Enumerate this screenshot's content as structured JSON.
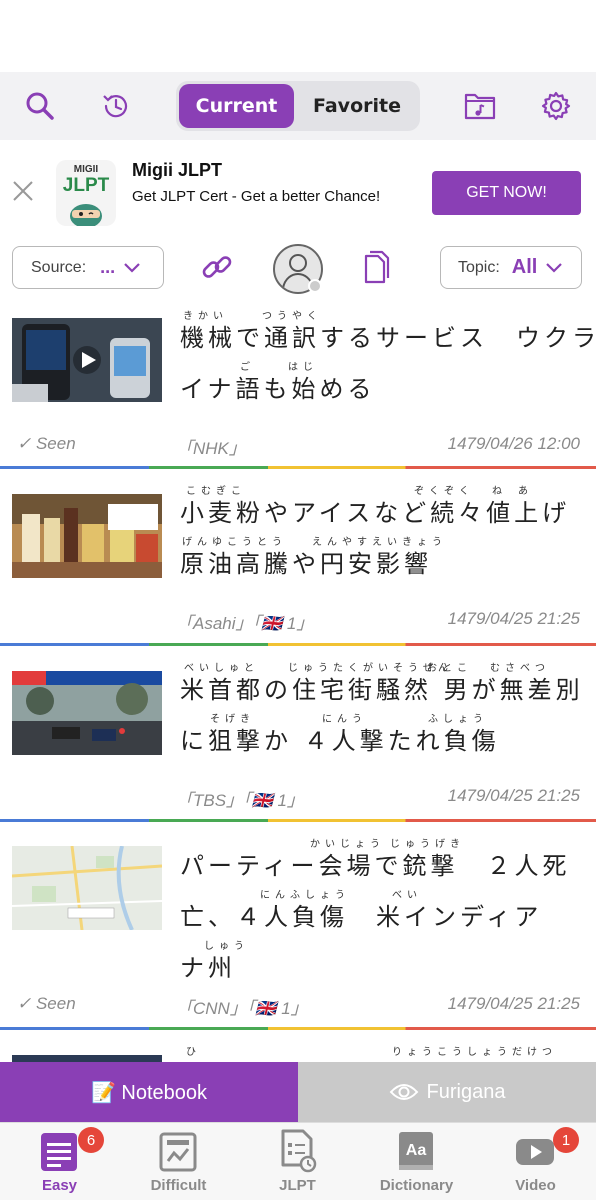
{
  "toolbar": {
    "segment_current": "Current",
    "segment_favorite": "Favorite",
    "icons": [
      "search-icon",
      "history-icon",
      "music-folder-icon",
      "settings-icon"
    ]
  },
  "ad": {
    "logo_top": "MIGII",
    "logo_main": "JLPT",
    "title": "Migii JLPT",
    "subtitle": "Get JLPT Cert - Get a better Chance!",
    "button": "GET NOW!"
  },
  "filters": {
    "source_label": "Source:",
    "source_value": "...",
    "topic_label": "Topic:",
    "topic_value": "All"
  },
  "articles": [
    {
      "lines": [
        {
          "text": "機械で通訳するサービス　ウクラ",
          "ruby": [
            {
              "text": "きかい"
            },
            {
              "text": "つうやく"
            }
          ]
        },
        {
          "text": "イナ語も始める",
          "ruby": [
            {
              "text": "ご"
            },
            {
              "text": "はじ"
            }
          ]
        }
      ],
      "seen": "✓ Seen",
      "source": "「NHK」",
      "date": "1479/04/26 12:00"
    },
    {
      "lines": [
        {
          "text": "小麦粉やアイスなど続々値上げ",
          "ruby": [
            {
              "text": "こむぎこ"
            },
            {
              "text": "ぞくぞく"
            },
            {
              "text": "ね"
            },
            {
              "text": "あ"
            }
          ]
        },
        {
          "text": "原油高騰や円安影響",
          "ruby": [
            {
              "text": "げんゆこうとう"
            },
            {
              "text": "えんやすえいきょう"
            }
          ]
        }
      ],
      "seen": "",
      "source": "「Asahi」「🇬🇧 1」",
      "date": "1479/04/25 21:25"
    },
    {
      "lines": [
        {
          "text": "米首都の住宅街騒然 男が無差別",
          "ruby": [
            {
              "text": "べいしゅと"
            },
            {
              "text": "じゅうたくがいそうぜん"
            },
            {
              "text": "おとこ"
            },
            {
              "text": "むさべつ"
            }
          ]
        },
        {
          "text": "に狙撃か ４人撃たれ負傷",
          "ruby": [
            {
              "text": "そげき"
            },
            {
              "text": "にんう"
            },
            {
              "text": "ふしょう"
            }
          ]
        }
      ],
      "seen": "",
      "source": "「TBS」「🇬🇧 1」",
      "date": "1479/04/25 21:25"
    },
    {
      "lines": [
        {
          "text": "パーティー会場で銃撃　２人死",
          "ruby": [
            {
              "text": "かいじょう"
            },
            {
              "text": "じゅうげき"
            }
          ]
        },
        {
          "text": "亡、４人負傷　米インディア",
          "ruby": [
            {
              "text": "にんふしょう"
            },
            {
              "text": "べい"
            }
          ]
        },
        {
          "text": "ナ州",
          "ruby": [
            {
              "text": "しゅう"
            }
          ]
        }
      ],
      "seen": "✓ Seen",
      "source": "「CNN」「🇬🇧 1」",
      "date": "1479/04/25 21:25"
    },
    {
      "lines": [
        {
          "text": "",
          "ruby": [
            {
              "text": "ひ"
            },
            {
              "text": "りょうこうしょうだけつ"
            }
          ]
        }
      ],
      "seen": "",
      "source": "",
      "date": ""
    }
  ],
  "action_bar": {
    "notebook": "📝 Notebook",
    "furigana": "Furigana"
  },
  "tabs": [
    {
      "label": "Easy",
      "badge": "6",
      "active": true
    },
    {
      "label": "Difficult",
      "badge": "",
      "active": false
    },
    {
      "label": "JLPT",
      "badge": "",
      "active": false
    },
    {
      "label": "Dictionary",
      "badge": "",
      "active": false
    },
    {
      "label": "Video",
      "badge": "1",
      "active": false
    }
  ],
  "colors": {
    "accent": "#8a3fb5",
    "badge": "#e5463a",
    "divider": [
      "#4a7bd6",
      "#49a954",
      "#f1c232",
      "#e25a4a"
    ]
  }
}
